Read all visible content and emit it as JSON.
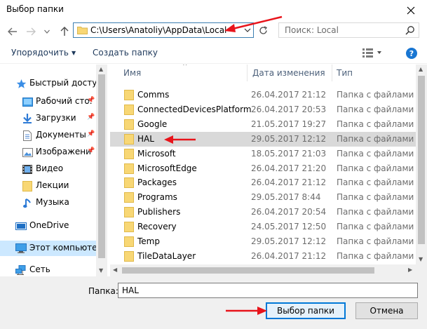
{
  "window": {
    "title": "Выбор папки"
  },
  "address": {
    "path": "C:\\Users\\Anatoliy\\AppData\\Local"
  },
  "search": {
    "placeholder": "Поиск: Local"
  },
  "toolbar": {
    "organize": "Упорядочить",
    "new_folder": "Создать папку"
  },
  "sidebar": {
    "items": [
      {
        "label": "Быстрый доступ",
        "icon": "star-icon",
        "pinned": false
      },
      {
        "label": "Рабочий сто.",
        "icon": "desktop-icon",
        "pinned": true
      },
      {
        "label": "Загрузки",
        "icon": "download-icon",
        "pinned": true
      },
      {
        "label": "Документы",
        "icon": "documents-icon",
        "pinned": true
      },
      {
        "label": "Изображени",
        "icon": "pictures-icon",
        "pinned": true
      },
      {
        "label": "Видео",
        "icon": "video-icon",
        "pinned": false
      },
      {
        "label": "Лекции",
        "icon": "folder-icon",
        "pinned": false
      },
      {
        "label": "Музыка",
        "icon": "music-icon",
        "pinned": false
      },
      {
        "label": "OneDrive",
        "icon": "onedrive-icon",
        "pinned": false
      },
      {
        "label": "Этот компьютер",
        "icon": "computer-icon",
        "pinned": false,
        "selected": true
      },
      {
        "label": "Сеть",
        "icon": "network-icon",
        "pinned": false
      }
    ]
  },
  "columns": {
    "name": "Имя",
    "date": "Дата изменения",
    "type": "Тип"
  },
  "files": [
    {
      "name": "Comms",
      "date": "26.04.2017 21:12",
      "type": "Папка с файлами"
    },
    {
      "name": "ConnectedDevicesPlatform",
      "date": "26.04.2017 20:53",
      "type": "Папка с файлами"
    },
    {
      "name": "Google",
      "date": "21.05.2017 19:27",
      "type": "Папка с файлами"
    },
    {
      "name": "HAL",
      "date": "29.05.2017 12:12",
      "type": "Папка с файлами",
      "selected": true
    },
    {
      "name": "Microsoft",
      "date": "18.05.2017 21:03",
      "type": "Папка с файлами"
    },
    {
      "name": "MicrosoftEdge",
      "date": "26.04.2017 21:20",
      "type": "Папка с файлами"
    },
    {
      "name": "Packages",
      "date": "26.04.2017 21:12",
      "type": "Папка с файлами"
    },
    {
      "name": "Programs",
      "date": "29.05.2017 8:44",
      "type": "Папка с файлами"
    },
    {
      "name": "Publishers",
      "date": "26.04.2017 20:54",
      "type": "Папка с файлами"
    },
    {
      "name": "Recovery",
      "date": "24.05.2017 12:50",
      "type": "Папка с файлами"
    },
    {
      "name": "Temp",
      "date": "29.05.2017 12:12",
      "type": "Папка с файлами"
    },
    {
      "name": "TileDataLayer",
      "date": "26.04.2017 21:12",
      "type": "Папка с файлами"
    }
  ],
  "footer": {
    "folder_label": "Папка:",
    "folder_value": "HAL",
    "select_button": "Выбор папки",
    "cancel_button": "Отмена"
  },
  "colors": {
    "accent": "#0078d7",
    "annotation_arrow": "#e8141b",
    "folder": "#f8d775"
  }
}
